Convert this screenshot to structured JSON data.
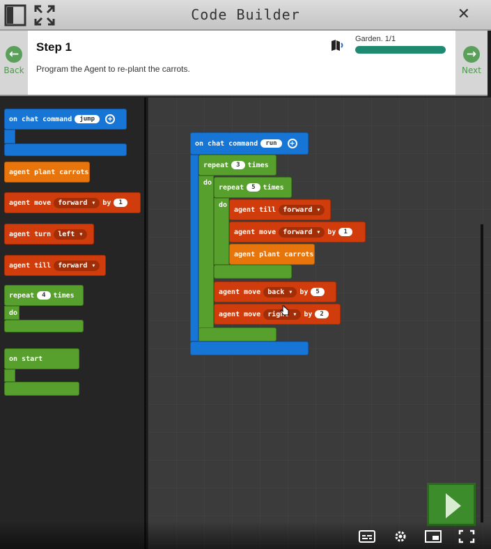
{
  "window": {
    "title": "Code Builder",
    "close": "✕"
  },
  "tutorial": {
    "back": "Back",
    "next": "Next",
    "step": "Step 1",
    "description": "Program the Agent to re-plant the carrots.",
    "progress_label": "Garden.  1/1",
    "progress": 1.0
  },
  "toolbox": {
    "chat_cmd": {
      "label": "on chat command",
      "arg": "jump"
    },
    "plant": "agent plant carrots",
    "move": {
      "label": "agent move",
      "dir": "forward ▾",
      "by": "by",
      "n": "1"
    },
    "turn": {
      "label": "agent turn",
      "dir": "left ▾"
    },
    "till": {
      "label": "agent till",
      "dir": "forward ▾"
    },
    "repeat": {
      "label": "repeat",
      "n": "4",
      "times": "times",
      "do": "do"
    },
    "on_start": "on start"
  },
  "workspace": {
    "chat_cmd": {
      "label": "on chat command",
      "arg": "run"
    },
    "outer_repeat": {
      "label": "repeat",
      "n": "3",
      "times": "times",
      "do": "do"
    },
    "inner_repeat": {
      "label": "repeat",
      "n": "5",
      "times": "times",
      "do": "do"
    },
    "till": {
      "label": "agent till",
      "dir": "forward ▾"
    },
    "move1": {
      "label": "agent move",
      "dir": "forward ▾",
      "by": "by",
      "n": "1"
    },
    "plant": "agent plant carrots",
    "move2": {
      "label": "agent move",
      "dir": "back ▾",
      "by": "by",
      "n": "5"
    },
    "move3": {
      "label": "agent move",
      "dir": "right ▾",
      "by": "by",
      "n": "2"
    }
  },
  "colors": {
    "event": "#1775d5",
    "agent": "#d03c0b",
    "plant": "#e8750b",
    "loop": "#57a02e",
    "run": "#3c8c2c"
  },
  "icons": [
    "layout-icon",
    "fullscreen-icon",
    "close-icon",
    "back-arrow-icon",
    "next-arrow-icon",
    "book-audio-icon",
    "run-play-icon",
    "captions-icon",
    "settings-icon",
    "miniplayer-icon",
    "fullscreen-player-icon"
  ]
}
